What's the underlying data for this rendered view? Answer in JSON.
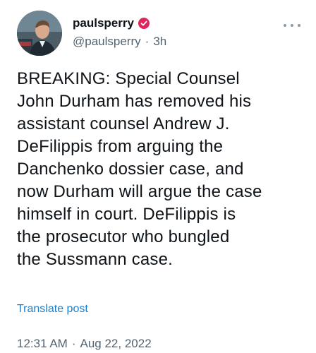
{
  "author": {
    "display_name": "paulsperry",
    "handle": "@paulsperry",
    "separator": "·",
    "relative_time": "3h",
    "verified": true,
    "avatar_icon": "profile-photo"
  },
  "tweet": {
    "text": "BREAKING: Special Counsel\nJohn Durham has removed his\nassistant counsel Andrew J.\nDeFilippis from arguing the\nDanchenko dossier case, and\nnow Durham will argue the case\nhimself in court. DeFilippis is\nthe prosecutor who bungled\nthe Sussmann case."
  },
  "actions": {
    "translate_label": "Translate post",
    "more_icon": "more-horizontal-icon"
  },
  "meta": {
    "time": "12:31 AM",
    "separator": "·",
    "date": "Aug 22, 2022"
  },
  "colors": {
    "text": "#0f1419",
    "secondary": "#536471",
    "link": "#1d7fcc",
    "verified_badge": "#e0245e"
  }
}
